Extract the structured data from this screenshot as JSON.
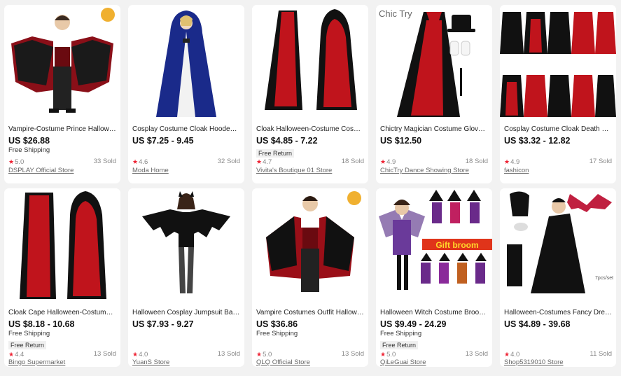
{
  "products": [
    {
      "title": "Vampire-Costume Prince Hallowee...",
      "price": "US $26.88",
      "shipping": "Free Shipping",
      "returns": "",
      "rating": "5.0",
      "sold": "33 Sold",
      "store": "DSPLAY Official Store"
    },
    {
      "title": "Cosplay Costume Cloak Hooded V...",
      "price": "US $7.25 - 9.45",
      "shipping": "",
      "returns": "",
      "rating": "4.6",
      "sold": "32 Sold",
      "store": "Moda Home"
    },
    {
      "title": "Cloak Halloween-Costume Cosplay...",
      "price": "US $4.85 - 7.22",
      "shipping": "",
      "returns": "Free Return",
      "rating": "4.7",
      "sold": "18 Sold",
      "store": "Vivita's Boutique 01 Store"
    },
    {
      "title": "Chictry Magician Costume Gloves-...",
      "price": "US $12.50",
      "shipping": "",
      "returns": "",
      "rating": "4.9",
      "sold": "18 Sold",
      "store": "ChicTry Dance Showing Store",
      "brand": "Chic Try"
    },
    {
      "title": "Cosplay Costume Cloak Death Perf...",
      "price": "US $3.32 - 12.82",
      "shipping": "",
      "returns": "",
      "rating": "4.9",
      "sold": "17 Sold",
      "store": "fashicon"
    },
    {
      "title": "Cloak Cape Halloween-Costume C...",
      "price": "US $8.18 - 10.68",
      "shipping": "Free Shipping",
      "returns": "Free Return",
      "rating": "4.4",
      "sold": "13 Sold",
      "store": "Bingo Supermarket"
    },
    {
      "title": "Halloween Cosplay Jumpsuit Batm...",
      "price": "US $7.93 - 9.27",
      "shipping": "",
      "returns": "",
      "rating": "4.0",
      "sold": "13 Sold",
      "store": "YuanS Store"
    },
    {
      "title": "Vampire Costumes Outfit Hallowe...",
      "price": "US $36.86",
      "shipping": "Free Shipping",
      "returns": "",
      "rating": "5.0",
      "sold": "13 Sold",
      "store": "QLQ Official Store"
    },
    {
      "title": "Halloween Witch Costume Broom ...",
      "price": "US $9.49 - 24.29",
      "shipping": "Free Shipping",
      "returns": "Free Return",
      "rating": "5.0",
      "sold": "13 Sold",
      "store": "QiLeGuai Store",
      "overlay_text": "Gift broom"
    },
    {
      "title": "Halloween-Costumes Fancy Dress ...",
      "price": "US $4.89 - 39.68",
      "shipping": "",
      "returns": "",
      "rating": "4.0",
      "sold": "11 Sold",
      "store": "Shop5319010 Store",
      "overlay_text": "7pcs/set"
    }
  ],
  "star_glyph": "★",
  "colors": {
    "star": "#e2231a",
    "cape_red": "#b3121b",
    "cape_black": "#111111",
    "velvet_blue": "#1a2a8a"
  }
}
